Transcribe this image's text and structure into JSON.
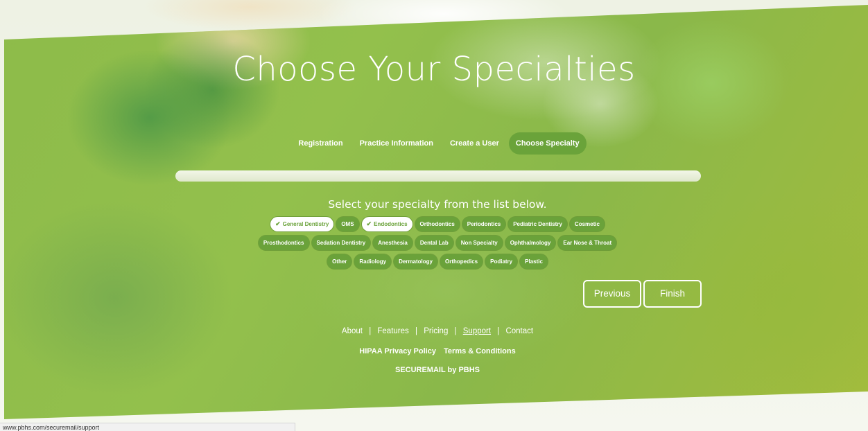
{
  "page": {
    "title": "Choose Your Specialties"
  },
  "steps": [
    {
      "label": "Registration"
    },
    {
      "label": "Practice Information"
    },
    {
      "label": "Create a User"
    },
    {
      "label": "Choose Specialty"
    }
  ],
  "progress": {
    "percent": 100
  },
  "specialties": {
    "prompt": "Select your specialty from the list below.",
    "rows": [
      [
        {
          "label": "General Dentistry",
          "selected": true
        },
        {
          "label": "OMS",
          "selected": false
        },
        {
          "label": "Endodontics",
          "selected": true
        },
        {
          "label": "Orthodontics",
          "selected": false
        },
        {
          "label": "Periodontics",
          "selected": false
        },
        {
          "label": "Pediatric Dentistry",
          "selected": false
        },
        {
          "label": "Cosmetic",
          "selected": false
        }
      ],
      [
        {
          "label": "Prosthodontics",
          "selected": false
        },
        {
          "label": "Sedation Dentistry",
          "selected": false
        },
        {
          "label": "Anesthesia",
          "selected": false
        },
        {
          "label": "Dental Lab",
          "selected": false
        },
        {
          "label": "Non Specialty",
          "selected": false
        },
        {
          "label": "Ophthalmology",
          "selected": false
        },
        {
          "label": "Ear Nose & Throat",
          "selected": false
        }
      ],
      [
        {
          "label": "Other",
          "selected": false
        },
        {
          "label": "Radiology",
          "selected": false
        },
        {
          "label": "Dermatology",
          "selected": false
        },
        {
          "label": "Orthopedics",
          "selected": false
        },
        {
          "label": "Podiatry",
          "selected": false
        },
        {
          "label": "Plastic",
          "selected": false
        }
      ]
    ]
  },
  "buttons": {
    "previous": "Previous",
    "finish": "Finish"
  },
  "footer": {
    "links": [
      "About",
      "Features",
      "Pricing",
      "Support",
      "Contact"
    ],
    "separator": "|",
    "legal": [
      "HIPAA Privacy Policy",
      "Terms & Conditions"
    ],
    "brand": "SECUREMAIL by PBHS"
  },
  "statusbar": {
    "url": "www.pbhs.com/securemail/support"
  },
  "colors": {
    "accent_green": "#6aa23a",
    "text": "#ffffff"
  }
}
